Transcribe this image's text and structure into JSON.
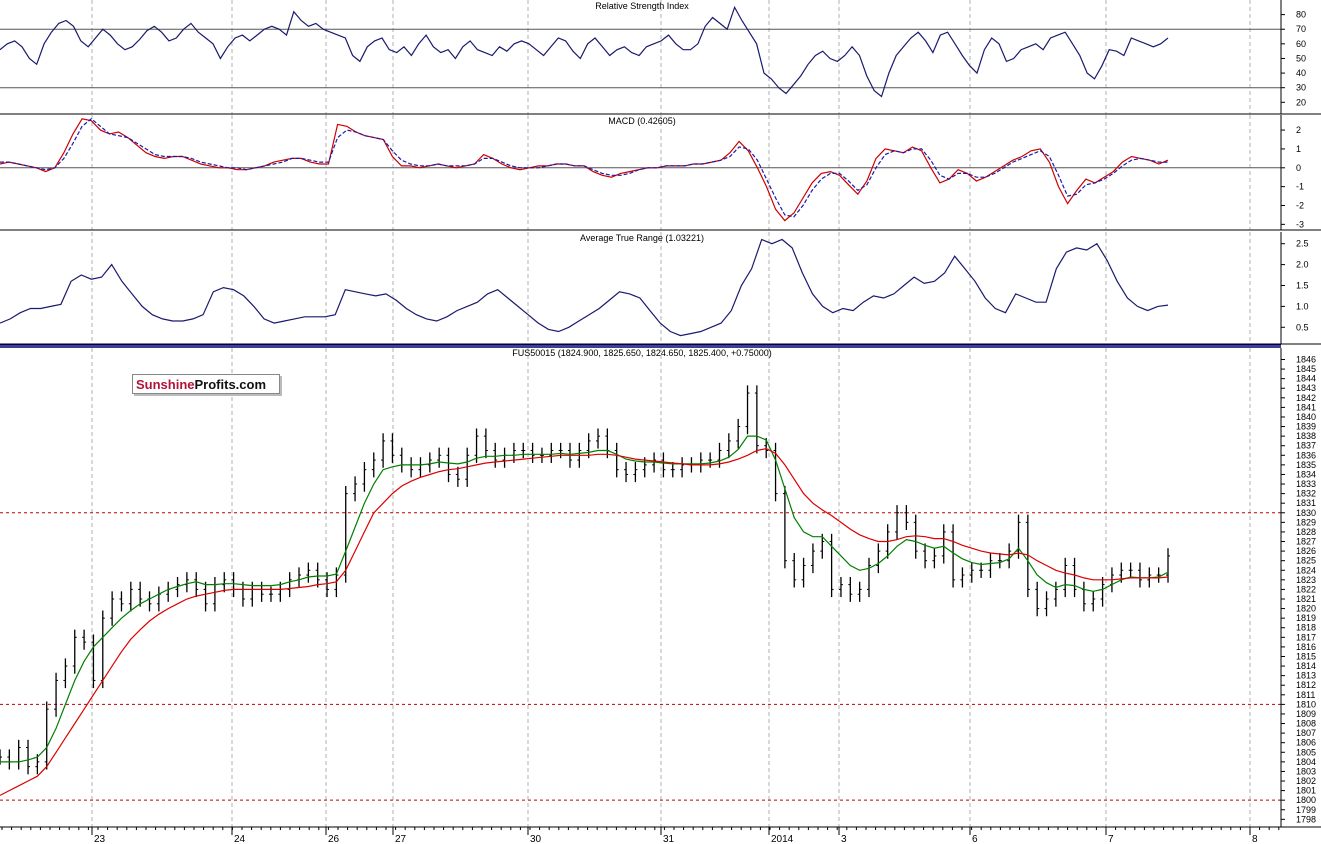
{
  "chart_data": [
    {
      "type": "line",
      "panel": "rsi",
      "title": "Relative Strength Index",
      "ylim": [
        12,
        90
      ],
      "ticks": [
        20,
        30,
        40,
        50,
        60,
        70,
        80
      ],
      "hlines": [
        70,
        30
      ],
      "series": [
        {
          "color": "#1a1a6e",
          "values": [
            56,
            60,
            62,
            58,
            50,
            46,
            60,
            68,
            74,
            76,
            72,
            62,
            58,
            64,
            70,
            66,
            60,
            56,
            58,
            63,
            69,
            72,
            68,
            62,
            64,
            70,
            74,
            68,
            64,
            60,
            50,
            58,
            64,
            66,
            62,
            66,
            70,
            72,
            70,
            66,
            82,
            76,
            72,
            74,
            70,
            68,
            66,
            64,
            52,
            48,
            58,
            62,
            64,
            56,
            54,
            58,
            52,
            60,
            66,
            58,
            54,
            56,
            50,
            58,
            62,
            56,
            54,
            52,
            58,
            55,
            60,
            62,
            60,
            56,
            52,
            58,
            64,
            62,
            55,
            50,
            60,
            64,
            58,
            52,
            56,
            58,
            54,
            52,
            58,
            60,
            62,
            66,
            60,
            56,
            56,
            60,
            72,
            78,
            74,
            70,
            85,
            76,
            68,
            60,
            40,
            36,
            30,
            26,
            32,
            38,
            46,
            52,
            55,
            50,
            48,
            52,
            58,
            52,
            38,
            28,
            24,
            40,
            52,
            58,
            64,
            68,
            62,
            54,
            66,
            68,
            60,
            52,
            45,
            40,
            56,
            64,
            60,
            48,
            50,
            56,
            58,
            60,
            56,
            64,
            66,
            68,
            60,
            52,
            40,
            36,
            45,
            56,
            55,
            52,
            64,
            62,
            60,
            58,
            60,
            64
          ]
        }
      ]
    },
    {
      "type": "line",
      "panel": "macd",
      "title": "MACD (0.42605)",
      "ylim": [
        -3.3,
        2.8
      ],
      "ticks": [
        -3,
        -2,
        -1,
        0,
        1,
        2
      ],
      "hlines": [
        0
      ],
      "series": [
        {
          "color": "#cc0000",
          "values": [
            0.2,
            0.3,
            0.2,
            0.1,
            0.0,
            -0.2,
            0.0,
            0.8,
            1.8,
            2.6,
            2.5,
            2.0,
            1.8,
            1.9,
            1.6,
            1.2,
            0.8,
            0.6,
            0.5,
            0.6,
            0.6,
            0.4,
            0.2,
            0.1,
            0.0,
            0.0,
            -0.1,
            -0.1,
            0.0,
            0.1,
            0.3,
            0.4,
            0.5,
            0.5,
            0.3,
            0.2,
            0.2,
            2.3,
            2.2,
            1.9,
            1.7,
            1.6,
            1.5,
            0.6,
            0.1,
            0.1,
            0.0,
            0.1,
            0.2,
            0.1,
            0.0,
            0.1,
            0.2,
            0.7,
            0.5,
            0.2,
            0.0,
            -0.1,
            0.0,
            0.1,
            0.1,
            0.2,
            0.2,
            0.1,
            0.1,
            -0.2,
            -0.4,
            -0.5,
            -0.3,
            -0.2,
            -0.1,
            0.0,
            0.0,
            0.1,
            0.1,
            0.1,
            0.2,
            0.2,
            0.3,
            0.4,
            0.8,
            1.4,
            0.9,
            0.0,
            -1.0,
            -2.2,
            -2.8,
            -2.4,
            -1.6,
            -0.8,
            -0.3,
            -0.2,
            -0.4,
            -0.9,
            -1.4,
            -0.7,
            0.5,
            1.0,
            0.9,
            0.8,
            1.1,
            0.9,
            0.0,
            -0.8,
            -0.6,
            -0.1,
            -0.3,
            -0.7,
            -0.5,
            -0.2,
            0.1,
            0.4,
            0.6,
            0.9,
            1.0,
            0.3,
            -1.0,
            -1.9,
            -1.2,
            -0.6,
            -0.8,
            -0.5,
            -0.2,
            0.3,
            0.6,
            0.5,
            0.4,
            0.2,
            0.4
          ]
        },
        {
          "color": "#1a1aaa",
          "dash": true,
          "values": [
            0.3,
            0.3,
            0.2,
            0.1,
            0.0,
            -0.1,
            0.0,
            0.5,
            1.3,
            2.2,
            2.6,
            2.2,
            1.8,
            1.7,
            1.6,
            1.3,
            1.0,
            0.7,
            0.6,
            0.6,
            0.6,
            0.5,
            0.3,
            0.2,
            0.1,
            0.0,
            0.0,
            -0.1,
            0.0,
            0.1,
            0.2,
            0.3,
            0.5,
            0.5,
            0.4,
            0.3,
            0.3,
            1.6,
            2.0,
            1.9,
            1.7,
            1.6,
            1.5,
            0.9,
            0.4,
            0.2,
            0.1,
            0.1,
            0.2,
            0.1,
            0.1,
            0.1,
            0.2,
            0.5,
            0.5,
            0.3,
            0.1,
            0.0,
            0.0,
            0.0,
            0.1,
            0.2,
            0.2,
            0.1,
            0.1,
            -0.1,
            -0.3,
            -0.4,
            -0.4,
            -0.3,
            -0.1,
            0.0,
            0.0,
            0.1,
            0.1,
            0.1,
            0.2,
            0.2,
            0.3,
            0.4,
            0.6,
            1.1,
            1.0,
            0.4,
            -0.6,
            -1.6,
            -2.5,
            -2.6,
            -2.0,
            -1.2,
            -0.6,
            -0.3,
            -0.3,
            -0.7,
            -1.2,
            -0.9,
            0.0,
            0.7,
            0.9,
            0.8,
            1.0,
            1.0,
            0.4,
            -0.4,
            -0.6,
            -0.3,
            -0.3,
            -0.5,
            -0.5,
            -0.3,
            0.0,
            0.3,
            0.5,
            0.7,
            0.9,
            0.6,
            -0.4,
            -1.5,
            -1.4,
            -0.9,
            -0.8,
            -0.6,
            -0.3,
            0.1,
            0.4,
            0.5,
            0.4,
            0.3,
            0.3
          ]
        }
      ]
    },
    {
      "type": "line",
      "panel": "atr",
      "title": "Average True Range (1.03221)",
      "ylim": [
        0.1,
        2.78
      ],
      "ticks": [
        0.5,
        1.0,
        1.5,
        2.0,
        2.5
      ],
      "series": [
        {
          "color": "#1a1a6e",
          "values": [
            0.6,
            0.7,
            0.85,
            0.95,
            0.95,
            1.0,
            1.05,
            1.6,
            1.75,
            1.65,
            1.7,
            2.0,
            1.6,
            1.3,
            1.0,
            0.8,
            0.7,
            0.65,
            0.65,
            0.7,
            0.8,
            1.35,
            1.45,
            1.4,
            1.25,
            1.0,
            0.7,
            0.6,
            0.65,
            0.7,
            0.75,
            0.75,
            0.75,
            0.8,
            1.4,
            1.35,
            1.3,
            1.25,
            1.3,
            1.15,
            0.95,
            0.8,
            0.7,
            0.65,
            0.75,
            0.9,
            1.0,
            1.1,
            1.3,
            1.4,
            1.2,
            1.0,
            0.8,
            0.6,
            0.45,
            0.4,
            0.5,
            0.65,
            0.8,
            0.95,
            1.15,
            1.35,
            1.3,
            1.2,
            0.9,
            0.6,
            0.4,
            0.3,
            0.35,
            0.4,
            0.5,
            0.6,
            0.9,
            1.5,
            1.9,
            2.6,
            2.5,
            2.6,
            2.4,
            1.8,
            1.3,
            1.0,
            0.85,
            0.95,
            0.9,
            1.1,
            1.25,
            1.2,
            1.3,
            1.5,
            1.7,
            1.55,
            1.6,
            1.8,
            2.2,
            1.9,
            1.6,
            1.2,
            0.95,
            0.85,
            1.3,
            1.2,
            1.1,
            1.1,
            1.9,
            2.3,
            2.4,
            2.35,
            2.5,
            2.1,
            1.6,
            1.2,
            1.0,
            0.9,
            1.0,
            1.03
          ]
        }
      ]
    },
    {
      "type": "line",
      "panel": "price",
      "title": "FUS50015 (1824.900, 1825.650, 1824.650, 1825.400, +0.75000)",
      "ylim": [
        1797.2,
        1847.2
      ],
      "ticks": [
        1798,
        1799,
        1800,
        1801,
        1802,
        1803,
        1804,
        1805,
        1806,
        1807,
        1808,
        1809,
        1810,
        1811,
        1812,
        1813,
        1814,
        1815,
        1816,
        1817,
        1818,
        1819,
        1820,
        1821,
        1822,
        1823,
        1824,
        1825,
        1826,
        1827,
        1828,
        1829,
        1830,
        1831,
        1832,
        1833,
        1834,
        1835,
        1836,
        1837,
        1838,
        1839,
        1840,
        1841,
        1842,
        1843,
        1844,
        1845,
        1846
      ],
      "hlines": [
        1830,
        1810,
        1800
      ],
      "x_labels": [
        "23",
        "24",
        "26",
        "27",
        "30",
        "31",
        "2014",
        "3",
        "6",
        "7",
        "8"
      ],
      "series": [
        {
          "name": "",
          "color": "#000000",
          "values": [
            1804.5,
            1804.0,
            1805.5,
            1803.5,
            1804.0,
            1809.5,
            1812.5,
            1814.0,
            1817.0,
            1816.5,
            1812.5,
            1819.0,
            1821.0,
            1820.5,
            1822.0,
            1821.0,
            1820.5,
            1821.5,
            1822.0,
            1822.5,
            1823.0,
            1822.0,
            1820.5,
            1822.5,
            1823.0,
            1822.0,
            1821.0,
            1822.0,
            1821.5,
            1821.5,
            1822.0,
            1823.0,
            1823.5,
            1824.0,
            1823.0,
            1822.0,
            1823.5,
            1832.0,
            1833.0,
            1834.5,
            1835.5,
            1837.5,
            1836.0,
            1835.0,
            1834.5,
            1835.0,
            1835.5,
            1836.0,
            1834.0,
            1833.5,
            1836.0,
            1838.0,
            1836.5,
            1835.5,
            1836.0,
            1836.5,
            1836.5,
            1836.0,
            1836.0,
            1836.5,
            1836.5,
            1835.5,
            1836.5,
            1837.5,
            1838.0,
            1836.5,
            1834.5,
            1834.0,
            1834.5,
            1835.0,
            1835.5,
            1834.5,
            1834.5,
            1835.0,
            1835.0,
            1835.5,
            1835.5,
            1836.5,
            1837.5,
            1839.0,
            1842.5,
            1837.0,
            1836.5,
            1832.0,
            1825.0,
            1823.0,
            1824.5,
            1826.0,
            1827.0,
            1822.0,
            1822.5,
            1821.5,
            1822.0,
            1824.5,
            1826.0,
            1828.0,
            1830.0,
            1829.0,
            1826.0,
            1825.0,
            1825.5,
            1828.0,
            1823.0,
            1823.5,
            1824.0,
            1824.0,
            1825.0,
            1825.0,
            1826.0,
            1829.0,
            1822.0,
            1820.0,
            1821.0,
            1822.0,
            1824.5,
            1822.0,
            1820.5,
            1821.0,
            1822.5,
            1823.5,
            1824.0,
            1824.0,
            1823.0,
            1823.5,
            1823.5,
            1825.5
          ]
        },
        {
          "name": "",
          "color": "#008000",
          "values": [
            1804.0,
            1804.0,
            1804.0,
            1804.2,
            1804.5,
            1805.5,
            1807.5,
            1810.0,
            1812.5,
            1814.5,
            1816.0,
            1817.0,
            1818.0,
            1819.0,
            1819.8,
            1820.5,
            1821.0,
            1821.5,
            1822.0,
            1822.3,
            1822.6,
            1822.8,
            1822.5,
            1822.5,
            1822.6,
            1822.6,
            1822.5,
            1822.4,
            1822.4,
            1822.4,
            1822.5,
            1822.8,
            1823.0,
            1823.3,
            1823.4,
            1823.4,
            1823.6,
            1826.0,
            1828.5,
            1831.0,
            1833.0,
            1834.5,
            1834.8,
            1835.0,
            1835.0,
            1835.0,
            1835.1,
            1835.3,
            1835.2,
            1835.1,
            1835.3,
            1835.7,
            1835.9,
            1835.9,
            1836.0,
            1836.0,
            1836.1,
            1836.1,
            1836.1,
            1836.1,
            1836.2,
            1836.1,
            1836.2,
            1836.3,
            1836.5,
            1836.5,
            1836.1,
            1835.6,
            1835.4,
            1835.3,
            1835.3,
            1835.2,
            1835.1,
            1835.1,
            1835.1,
            1835.1,
            1835.2,
            1835.4,
            1835.8,
            1836.6,
            1838.0,
            1838.0,
            1837.6,
            1835.5,
            1832.5,
            1829.5,
            1828.0,
            1827.5,
            1827.5,
            1826.5,
            1825.5,
            1824.5,
            1824.0,
            1824.2,
            1824.7,
            1825.5,
            1826.5,
            1827.2,
            1827.0,
            1826.6,
            1826.3,
            1826.5,
            1825.8,
            1825.2,
            1824.8,
            1824.6,
            1824.7,
            1824.8,
            1825.2,
            1826.3,
            1825.0,
            1823.5,
            1822.7,
            1822.2,
            1822.5,
            1822.4,
            1822.0,
            1821.8,
            1822.0,
            1822.5,
            1823.0,
            1823.3,
            1823.2,
            1823.2,
            1823.3,
            1823.8
          ]
        },
        {
          "name": "",
          "color": "#dd0000",
          "values": [
            1800.5,
            1801.0,
            1801.5,
            1802.0,
            1802.5,
            1803.5,
            1805.0,
            1806.5,
            1808.0,
            1809.5,
            1811.0,
            1812.5,
            1814.0,
            1815.5,
            1816.8,
            1817.8,
            1818.7,
            1819.4,
            1820.0,
            1820.5,
            1821.0,
            1821.3,
            1821.5,
            1821.7,
            1821.9,
            1822.0,
            1822.0,
            1822.0,
            1822.0,
            1822.0,
            1822.0,
            1822.1,
            1822.2,
            1822.3,
            1822.5,
            1822.6,
            1822.8,
            1824.0,
            1826.0,
            1828.0,
            1830.0,
            1831.0,
            1832.0,
            1832.8,
            1833.3,
            1833.7,
            1834.0,
            1834.3,
            1834.5,
            1834.6,
            1834.8,
            1835.0,
            1835.2,
            1835.3,
            1835.4,
            1835.5,
            1835.6,
            1835.7,
            1835.8,
            1835.9,
            1836.0,
            1836.0,
            1836.0,
            1836.0,
            1836.1,
            1836.1,
            1836.0,
            1835.8,
            1835.6,
            1835.5,
            1835.4,
            1835.3,
            1835.2,
            1835.1,
            1835.0,
            1835.0,
            1835.0,
            1835.1,
            1835.3,
            1835.6,
            1836.0,
            1836.5,
            1836.7,
            1836.2,
            1835.0,
            1833.5,
            1832.0,
            1831.0,
            1830.3,
            1829.7,
            1829.0,
            1828.3,
            1827.7,
            1827.3,
            1827.0,
            1827.0,
            1827.2,
            1827.5,
            1827.6,
            1827.5,
            1827.3,
            1827.3,
            1827.0,
            1826.6,
            1826.3,
            1826.0,
            1825.8,
            1825.7,
            1825.6,
            1825.8,
            1825.6,
            1825.0,
            1824.5,
            1824.0,
            1823.7,
            1823.5,
            1823.2,
            1823.0,
            1823.0,
            1823.0,
            1823.1,
            1823.2,
            1823.2,
            1823.2,
            1823.2,
            1823.3
          ]
        }
      ]
    }
  ],
  "logo": {
    "part1": "Sunshine",
    "part2": "Profits.com"
  },
  "colors": {
    "grid": "#b0b0b0",
    "ref_line": "#c00000",
    "axis": "#000000",
    "panel_sep": "#00006e"
  }
}
